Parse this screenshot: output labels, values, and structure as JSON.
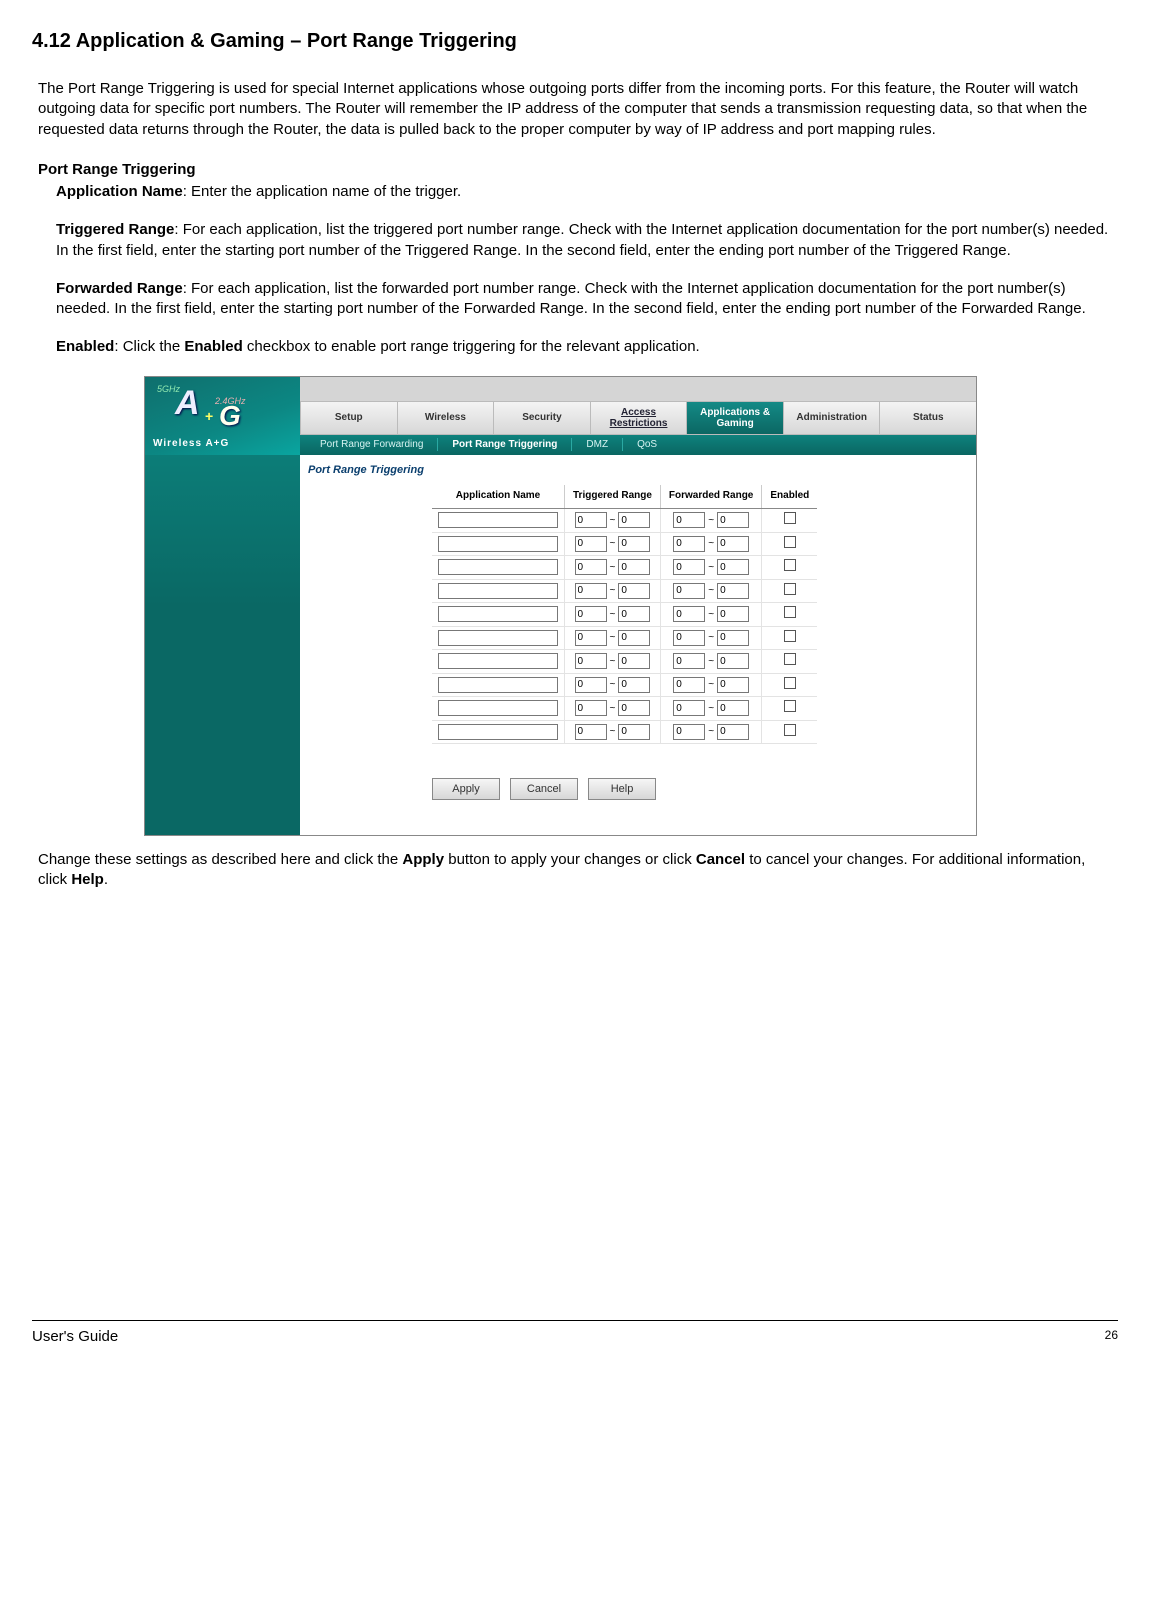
{
  "heading": "4.12 Application & Gaming – Port Range Triggering",
  "intro": "The Port Range Triggering is used for special Internet applications whose outgoing ports differ from the incoming ports. For this feature, the Router will watch outgoing data for specific port numbers. The Router will remember the IP address of the computer that sends a transmission requesting data, so that when the requested data returns through the Router, the data is pulled back to the proper computer by way of IP address and port mapping rules.",
  "section_label": "Port Range Triggering",
  "defs": {
    "app_name_term": "Application Name",
    "app_name_text": ": Enter the application name of the trigger.",
    "trig_term": "Triggered Range",
    "trig_text": ": For each application, list the triggered port number range. Check with the Internet application documentation for the port number(s) needed. In the first field, enter the starting port number of the Triggered Range. In the second field, enter the ending port number of the Triggered Range.",
    "fwd_term": "Forwarded Range",
    "fwd_text": ": For each application, list the forwarded port number range. Check with the Internet application documentation for the port number(s) needed. In the first field, enter the starting port number of the Forwarded Range. In the second field, enter the ending port number of the Forwarded Range.",
    "en_term": "Enabled",
    "en_pre": ": Click the ",
    "en_bold": "Enabled",
    "en_post": " checkbox to enable port range triggering for the relevant application."
  },
  "closing": {
    "pre": "Change these settings as described here and click the ",
    "apply": "Apply",
    "mid1": " button to apply your changes or click ",
    "cancel": "Cancel",
    "mid2": " to cancel your changes. For additional information, click ",
    "help": "Help",
    "post": "."
  },
  "logo": {
    "ghz5": "5GHz",
    "ghz24": "2.4GHz",
    "a": "A",
    "plus": "+",
    "g": "G",
    "brand": "Wireless A+G"
  },
  "tabs": [
    "Setup",
    "Wireless",
    "Security",
    "Access Restrictions",
    "Applications & Gaming",
    "Administration",
    "Status"
  ],
  "tabs_active": 4,
  "tabs_link_style": [
    3
  ],
  "subtabs": [
    "Port Range Forwarding",
    "Port Range Triggering",
    "DMZ",
    "QoS"
  ],
  "subtabs_active": 1,
  "side_title": "Port Range Triggering",
  "table": {
    "headers": [
      "Application Name",
      "Triggered Range",
      "Forwarded Range",
      "Enabled"
    ],
    "rows": [
      {
        "app": "",
        "ts": "0",
        "te": "0",
        "fs": "0",
        "fe": "0",
        "en": false
      },
      {
        "app": "",
        "ts": "0",
        "te": "0",
        "fs": "0",
        "fe": "0",
        "en": false
      },
      {
        "app": "",
        "ts": "0",
        "te": "0",
        "fs": "0",
        "fe": "0",
        "en": false
      },
      {
        "app": "",
        "ts": "0",
        "te": "0",
        "fs": "0",
        "fe": "0",
        "en": false
      },
      {
        "app": "",
        "ts": "0",
        "te": "0",
        "fs": "0",
        "fe": "0",
        "en": false
      },
      {
        "app": "",
        "ts": "0",
        "te": "0",
        "fs": "0",
        "fe": "0",
        "en": false
      },
      {
        "app": "",
        "ts": "0",
        "te": "0",
        "fs": "0",
        "fe": "0",
        "en": false
      },
      {
        "app": "",
        "ts": "0",
        "te": "0",
        "fs": "0",
        "fe": "0",
        "en": false
      },
      {
        "app": "",
        "ts": "0",
        "te": "0",
        "fs": "0",
        "fe": "0",
        "en": false
      },
      {
        "app": "",
        "ts": "0",
        "te": "0",
        "fs": "0",
        "fe": "0",
        "en": false
      }
    ],
    "tilde": "~"
  },
  "buttons": {
    "apply": "Apply",
    "cancel": "Cancel",
    "help": "Help"
  },
  "footer": {
    "guide": "User's Guide",
    "page": "26"
  }
}
